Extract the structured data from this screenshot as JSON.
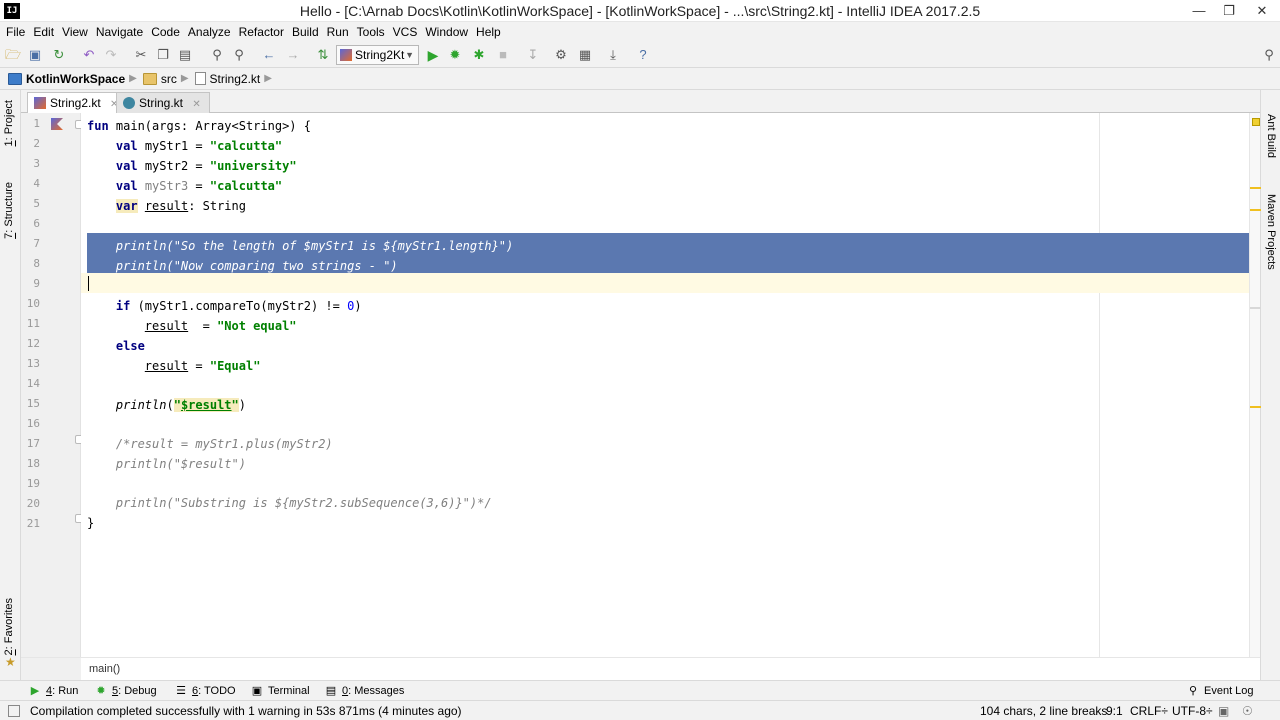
{
  "window": {
    "title": "Hello - [C:\\Arnab Docs\\Kotlin\\KotlinWorkSpace] - [KotlinWorkSpace] - ...\\src\\String2.kt] - IntelliJ IDEA 2017.2.5",
    "app_icon_text": "IJ"
  },
  "menu": [
    "File",
    "Edit",
    "View",
    "Navigate",
    "Code",
    "Analyze",
    "Refactor",
    "Build",
    "Run",
    "Tools",
    "VCS",
    "Window",
    "Help"
  ],
  "toolbar": {
    "run_config": "String2Kt"
  },
  "breadcrumb": [
    "KotlinWorkSpace",
    "src",
    "String2.kt"
  ],
  "left_tools": {
    "project": {
      "num": "1",
      "label": ": Project"
    },
    "structure": {
      "num": "7",
      "label": ": Structure"
    },
    "favorites": {
      "num": "2",
      "label": ": Favorites"
    }
  },
  "right_tools": {
    "ant": "Ant Build",
    "maven": "Maven Projects"
  },
  "tabs": [
    {
      "label": "String2.kt",
      "active": true
    },
    {
      "label": "String.kt",
      "active": false
    }
  ],
  "editor": {
    "line_numbers": [
      "1",
      "2",
      "3",
      "4",
      "5",
      "6",
      "7",
      "8",
      "9",
      "10",
      "11",
      "12",
      "13",
      "14",
      "15",
      "16",
      "17",
      "18",
      "19",
      "20",
      "21"
    ],
    "breadcrumb": "main()"
  },
  "tool_windows": [
    {
      "num": "4",
      "label": ": Run",
      "icon": "run-icon"
    },
    {
      "num": "5",
      "label": ": Debug",
      "icon": "debug-icon"
    },
    {
      "num": "6",
      "label": ": TODO",
      "icon": "todo-icon"
    },
    {
      "num": "",
      "label": "Terminal",
      "icon": "terminal-icon"
    },
    {
      "num": "0",
      "label": ": Messages",
      "icon": "messages-icon"
    }
  ],
  "event_log": "Event Log",
  "status": {
    "message": "Compilation completed successfully with 1 warning in 53s 871ms (4 minutes ago)",
    "chars": "104 chars, 2 line breaks",
    "position": "9:1",
    "line_sep": "CRLF÷",
    "encoding": "UTF-8÷"
  }
}
